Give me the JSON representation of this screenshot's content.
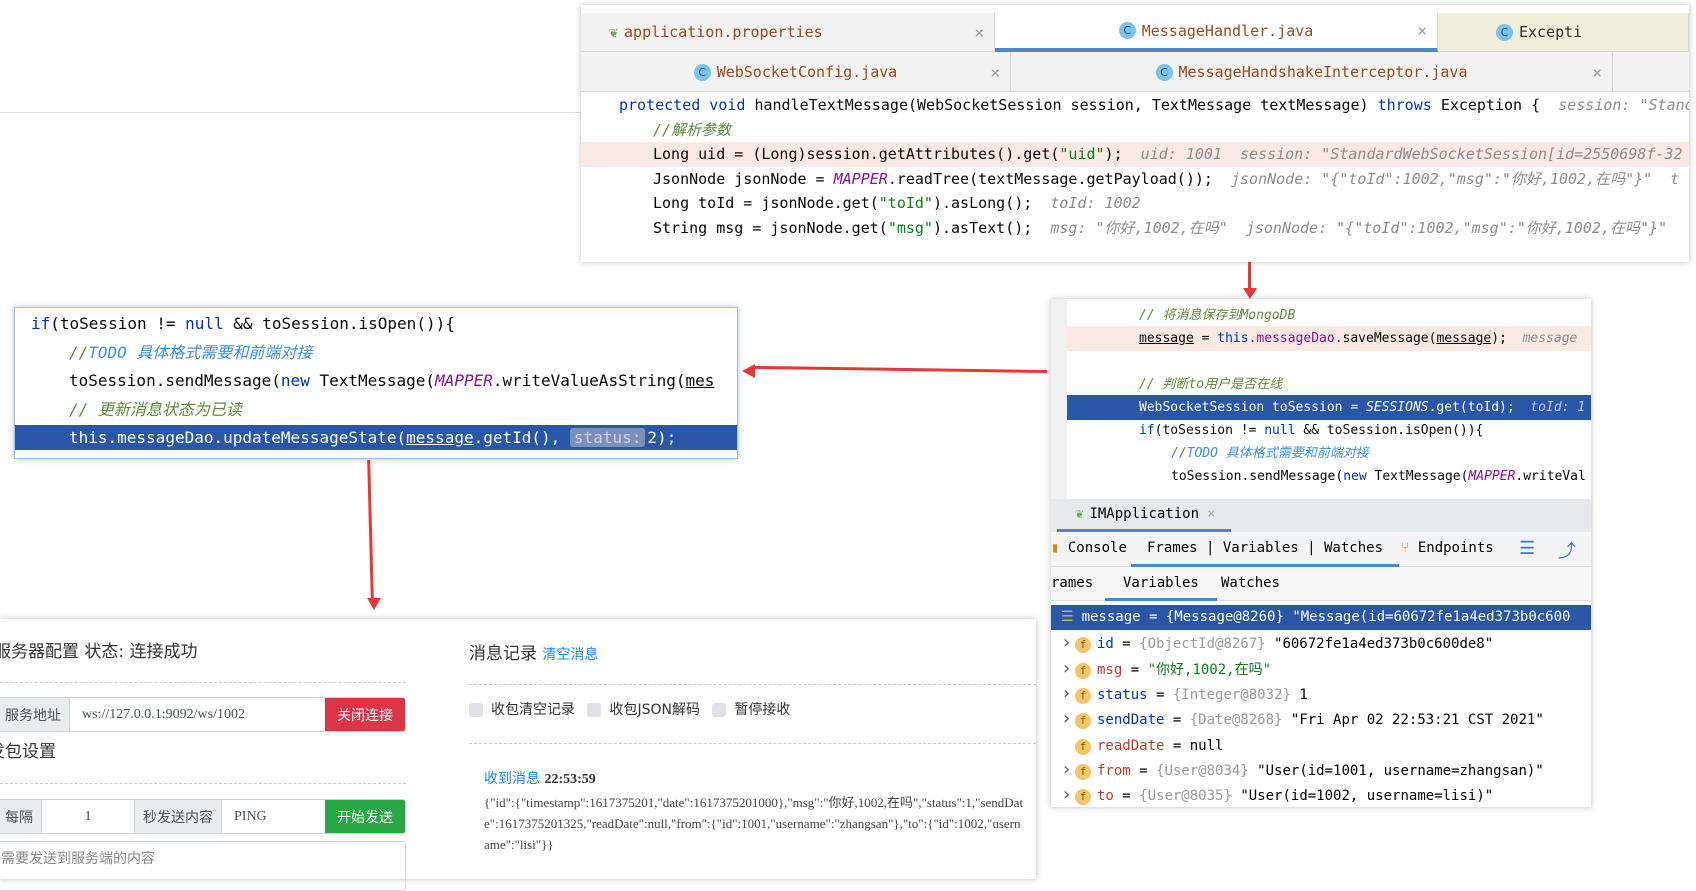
{
  "top_editor": {
    "tabs_row1": [
      {
        "label": "application.properties",
        "icon": "spring-properties-icon"
      },
      {
        "label": "MessageHandler.java",
        "icon": "class-icon",
        "active": true
      },
      {
        "label": "Excepti",
        "icon": "class-icon"
      }
    ],
    "tabs_row2": [
      {
        "label": "WebSocketConfig.java",
        "icon": "class-icon"
      },
      {
        "label": "MessageHandshakeInterceptor.java",
        "icon": "class-icon"
      }
    ],
    "close_glyph": "×",
    "class_glyph": "C",
    "lines": [
      {
        "indent": 0,
        "tokens": [
          [
            "kw",
            "protected void "
          ],
          [
            "",
            "handleTextMessage(WebSocketSession session, TextMessage textMessage) "
          ],
          [
            "kw",
            "throws "
          ],
          [
            "",
            "Exception {  "
          ],
          [
            "hint",
            "session: \"StandardWebSocketSession"
          ]
        ]
      },
      {
        "indent": 1,
        "tokens": [
          [
            "cmt",
            "//解析参数"
          ]
        ]
      },
      {
        "indent": 1,
        "hl": "breakpoint",
        "tokens": [
          [
            "",
            "Long uid = (Long)session.getAttributes().get("
          ],
          [
            "str",
            "\"uid\""
          ],
          [
            "",
            ");  "
          ],
          [
            "hint",
            "uid: 1001  session: \"StandardWebSocketSession[id=2550698f-32"
          ]
        ]
      },
      {
        "indent": 1,
        "tokens": [
          [
            "",
            "JsonNode jsonNode = "
          ],
          [
            "st",
            "MAPPER"
          ],
          [
            "",
            ".readTree(textMessage.getPayload());  "
          ],
          [
            "hint",
            "jsonNode: \"{\"toId\":1002,\"msg\":\"你好,1002,在吗\"}\"  t"
          ]
        ]
      },
      {
        "indent": 1,
        "tokens": [
          [
            "",
            "Long toId = jsonNode.get("
          ],
          [
            "str",
            "\"toId\""
          ],
          [
            "",
            ").asLong();  "
          ],
          [
            "hint",
            "toId: 1002"
          ]
        ]
      },
      {
        "indent": 1,
        "tokens": [
          [
            "",
            "String msg = jsonNode.get("
          ],
          [
            "str",
            "\"msg\""
          ],
          [
            "",
            ").asText();  "
          ],
          [
            "hint",
            "msg: \"你好,1002,在吗\"  jsonNode: \"{\"toId\":1002,\"msg\":\"你好,1002,在吗\"}\""
          ]
        ]
      }
    ]
  },
  "left_snippet": {
    "lines": [
      {
        "indent": 0,
        "tokens": [
          [
            "kw",
            "if"
          ],
          [
            "",
            "(toSession != "
          ],
          [
            "kw",
            "null"
          ],
          [
            "",
            " && toSession.isOpen()){"
          ]
        ]
      },
      {
        "indent": 1,
        "tokens": [
          [
            "cmt",
            "//"
          ],
          [
            "todo",
            "TODO 具体格式需要和前端对接"
          ]
        ]
      },
      {
        "indent": 1,
        "tokens": [
          [
            "",
            "toSession.sendMessage("
          ],
          [
            "kw",
            "new "
          ],
          [
            "",
            "TextMessage("
          ],
          [
            "st",
            "MAPPER"
          ],
          [
            "",
            ".writeValueAsString("
          ],
          [
            "ul",
            "mes"
          ]
        ]
      },
      {
        "indent": 1,
        "tokens": [
          [
            "cmt",
            "// 更新消息状态为已读"
          ]
        ]
      },
      {
        "indent": 1,
        "hl": "selected",
        "tokens": [
          [
            "",
            "this.messageDao.updateMessageState("
          ],
          [
            "ul",
            "message"
          ],
          [
            "",
            ".getId(), "
          ],
          [
            "badge",
            "status:"
          ],
          [
            "",
            "2);"
          ]
        ]
      }
    ]
  },
  "right_debugger": {
    "lines": [
      {
        "indent": 1,
        "tokens": [
          [
            "cmt",
            "// 将消息保存到MongoDB"
          ]
        ]
      },
      {
        "indent": 1,
        "hl": "breakpoint",
        "tokens": [
          [
            "ul",
            "message"
          ],
          [
            "",
            " = "
          ],
          [
            "kw",
            "this"
          ],
          [
            "",
            "."
          ],
          [
            "fld",
            "messageDao"
          ],
          [
            "",
            ".saveMessage("
          ],
          [
            "ul",
            "message"
          ],
          [
            "",
            ");  "
          ],
          [
            "hint",
            "message"
          ]
        ]
      },
      {
        "indent": 1,
        "tokens": []
      },
      {
        "indent": 1,
        "tokens": [
          [
            "cmt",
            "// 判断to用户是否在线"
          ]
        ]
      },
      {
        "indent": 1,
        "hl": "selected",
        "tokens": [
          [
            "",
            "WebSocketSession toSession = "
          ],
          [
            "st",
            "SESSIONS"
          ],
          [
            "",
            ".get(toId);  "
          ],
          [
            "hint",
            "toId: 1"
          ]
        ]
      },
      {
        "indent": 1,
        "tokens": [
          [
            "kw",
            "if"
          ],
          [
            "",
            "(toSession != "
          ],
          [
            "kw",
            "null"
          ],
          [
            "",
            " && toSession.isOpen()){"
          ]
        ]
      },
      {
        "indent": 2,
        "tokens": [
          [
            "cmt",
            "//"
          ],
          [
            "todo",
            "TODO 具体格式需要和前端对接"
          ]
        ]
      },
      {
        "indent": 2,
        "tokens": [
          [
            "",
            "toSession.sendMessage("
          ],
          [
            "kw",
            "new "
          ],
          [
            "",
            "TextMessage("
          ],
          [
            "st",
            "MAPPER"
          ],
          [
            "",
            ".writeVal"
          ]
        ]
      }
    ],
    "run_tab": "IMApplication",
    "toolbar": {
      "console": "Console",
      "frames_vars_watches": "Frames | Variables | Watches",
      "endpoints": "Endpoints"
    },
    "subtabs": [
      "rames",
      "Variables",
      "Watches"
    ],
    "variables": [
      {
        "name": "message",
        "type": "{Message@8260}",
        "value": "\"Message(id=60672fe1a4ed373b0c600",
        "selected": true,
        "icon": "list-icon"
      },
      {
        "name": "id",
        "type": "{ObjectId@8267}",
        "value": "\"60672fe1a4ed373b0c600de8\"",
        "expand": true,
        "ncolor": "#0033b3"
      },
      {
        "name": "msg",
        "type": "",
        "value": "\"你好,1002,在吗\"",
        "expand": true,
        "ncolor": "#c0392b",
        "vcolor": "#067d17"
      },
      {
        "name": "status",
        "type": "{Integer@8032}",
        "value": "1",
        "expand": true,
        "ncolor": "#0033b3"
      },
      {
        "name": "sendDate",
        "type": "{Date@8268}",
        "value": "\"Fri Apr 02 22:53:21 CST 2021\"",
        "expand": true,
        "ncolor": "#0033b3"
      },
      {
        "name": "readDate",
        "type": "",
        "value": "null",
        "expand": false,
        "ncolor": "#c0392b"
      },
      {
        "name": "from",
        "type": "{User@8034}",
        "value": "\"User(id=1001, username=zhangsan)\"",
        "expand": true,
        "ncolor": "#c0392b"
      },
      {
        "name": "to",
        "type": "{User@8035}",
        "value": "\"User(id=1002, username=lisi)\"",
        "expand": true,
        "ncolor": "#c0392b"
      }
    ]
  },
  "web_client": {
    "server_config": "服务器配置 状态: 连接成功",
    "server_address_label": "服务地址",
    "server_address": "ws://127.0.0.1:9092/ws/1002",
    "close_button": "关闭连接",
    "send_settings": "发包设置",
    "every_label": "每隔",
    "interval": "1",
    "send_content_label": "秒发送内容",
    "ping": "PING",
    "start_button": "开始发送",
    "message_placeholder": "需要发送到服务端的内容",
    "log_title": "消息记录",
    "clear_link": "清空消息",
    "options": [
      "收包清空记录",
      "收包JSON解码",
      "暂停接收"
    ],
    "received_label": "收到消息",
    "received_time": "22:53:59",
    "received_body": "{\"id\":{\"timestamp\":1617375201,\"date\":1617375201000},\"msg\":\"你好,1002,在吗\",\"status\":1,\"sendDate\":1617375201325,\"readDate\":null,\"from\":{\"id\":1001,\"username\":\"zhangsan\"},\"to\":{\"id\":1002,\"username\":\"lisi\"}}"
  },
  "colors": {
    "accent": "#4a88c7",
    "selection": "#2a56a8",
    "breakpoint": "#fae8e3",
    "danger": "#dc3545",
    "success": "#28a745",
    "arrow": "#e53935"
  }
}
